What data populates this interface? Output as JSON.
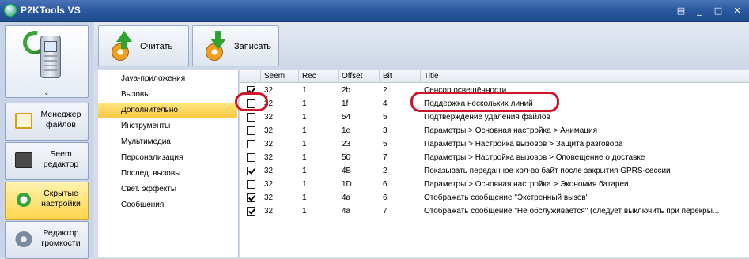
{
  "window": {
    "title": "P2KTools VS",
    "controls": [
      "▤",
      "_",
      "□",
      "✕"
    ]
  },
  "nav": {
    "logo_chevron": "⌄",
    "buttons": [
      {
        "label": "Менеджер файлов",
        "icon": "folder-icon"
      },
      {
        "label": "Seem редактор",
        "icon": "seem-icon"
      },
      {
        "label": "Скрытые настройки",
        "icon": "settings-gear-icon",
        "active": true
      },
      {
        "label": "Редактор громкости",
        "icon": "speaker-icon"
      }
    ]
  },
  "toolbar": {
    "read_label": "Считать",
    "write_label": "Записать"
  },
  "categories": [
    "Java-приложения",
    "Вызовы",
    "Дополнительно",
    "Инструменты",
    "Мультимедиа",
    "Персонализация",
    "Послед. вызовы",
    "Свет. эффекты",
    "Сообщения"
  ],
  "selected_category": "Дополнительно",
  "grid": {
    "headers": [
      "Seem",
      "Rec",
      "Offset",
      "Bit",
      "Title"
    ],
    "rows": [
      {
        "checked": true,
        "seem": "32",
        "rec": "1",
        "offset": "2b",
        "bit": "2",
        "title": "Сенсор освещённости"
      },
      {
        "checked": false,
        "seem": "32",
        "rec": "1",
        "offset": "1f",
        "bit": "4",
        "title": "Поддержка нескольких линий"
      },
      {
        "checked": false,
        "seem": "32",
        "rec": "1",
        "offset": "54",
        "bit": "5",
        "title": "Подтверждение удаления файлов"
      },
      {
        "checked": false,
        "seem": "32",
        "rec": "1",
        "offset": "1e",
        "bit": "3",
        "title": "Параметры > Основная настройка > Анимация"
      },
      {
        "checked": false,
        "seem": "32",
        "rec": "1",
        "offset": "23",
        "bit": "5",
        "title": "Параметры > Настройка вызовов > Защита разговора"
      },
      {
        "checked": false,
        "seem": "32",
        "rec": "1",
        "offset": "50",
        "bit": "7",
        "title": "Параметры > Настройка вызовов > Оповещение о доставке"
      },
      {
        "checked": true,
        "seem": "32",
        "rec": "1",
        "offset": "4B",
        "bit": "2",
        "title": "Показывать переданное кол-во байт после закрытия GPRS-сессии"
      },
      {
        "checked": false,
        "seem": "32",
        "rec": "1",
        "offset": "1D",
        "bit": "6",
        "title": "Параметры > Основная настройка > Экономия батареи"
      },
      {
        "checked": true,
        "seem": "32",
        "rec": "1",
        "offset": "4a",
        "bit": "6",
        "title": "Отображать сообщение \"Экстренный вызов\""
      },
      {
        "checked": true,
        "seem": "32",
        "rec": "1",
        "offset": "4a",
        "bit": "7",
        "title": "Отображать сообщение \"Не обслуживается\" (следует выключить при перекры..."
      }
    ]
  },
  "colors": {
    "titlebar": "#2c5aa0",
    "active_nav": "#ffd64d",
    "selected_category": "#f8c840",
    "annotation": "#d0142c"
  }
}
